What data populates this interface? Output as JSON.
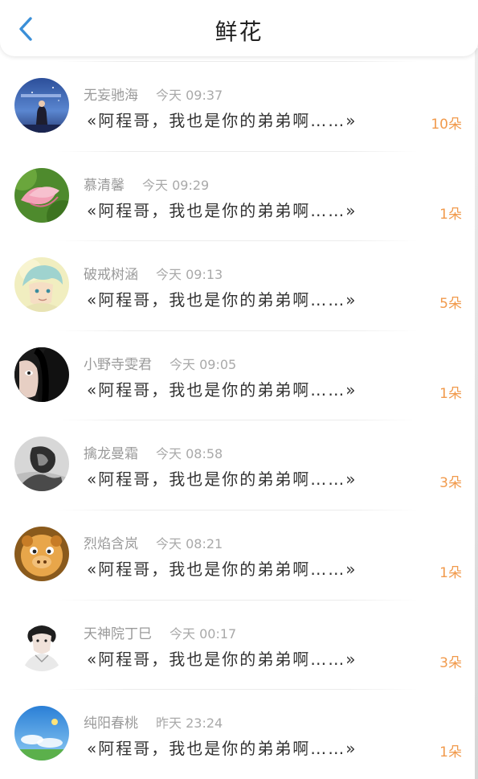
{
  "header": {
    "title": "鲜花",
    "back_icon": "chevron-left-icon",
    "accent_color": "#3a8fd8"
  },
  "colors": {
    "count": "#f19a4c",
    "meta": "#9a9a9a",
    "message": "#333333"
  },
  "items": [
    {
      "name": "无妄驰海",
      "time": "今天 09:37",
      "message": "«阿程哥，我也是你的弟弟啊……»",
      "count": "10朵",
      "avatar": "avatar-girl-night-sky"
    },
    {
      "name": "慕清馨",
      "time": "今天 09:29",
      "message": "«阿程哥，我也是你的弟弟啊……»",
      "count": "1朵",
      "avatar": "avatar-pink-lotus"
    },
    {
      "name": "破戒树涵",
      "time": "今天 09:13",
      "message": "«阿程哥，我也是你的弟弟啊……»",
      "count": "5朵",
      "avatar": "avatar-anime-boy"
    },
    {
      "name": "小野寺雯君",
      "time": "今天 09:05",
      "message": "«阿程哥，我也是你的弟弟啊……»",
      "count": "1朵",
      "avatar": "avatar-dark-hair-face"
    },
    {
      "name": "擒龙曼霜",
      "time": "今天 08:58",
      "message": "«阿程哥，我也是你的弟弟啊……»",
      "count": "3朵",
      "avatar": "avatar-bw-sketch"
    },
    {
      "name": "烈焰含岚",
      "time": "今天 08:21",
      "message": "«阿程哥，我也是你的弟弟啊……»",
      "count": "1朵",
      "avatar": "avatar-cartoon-pig"
    },
    {
      "name": "天神院丁巳",
      "time": "今天 00:17",
      "message": "«阿程哥，我也是你的弟弟啊……»",
      "count": "3朵",
      "avatar": "avatar-bw-portrait"
    },
    {
      "name": "纯阳春桃",
      "time": "昨天 23:24",
      "message": "«阿程哥，我也是你的弟弟啊……»",
      "count": "1朵",
      "avatar": "avatar-blue-sky"
    }
  ]
}
